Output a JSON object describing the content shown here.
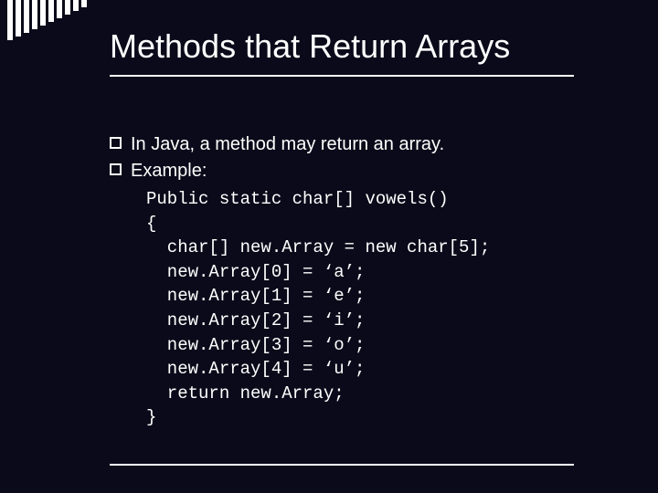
{
  "title": "Methods that Return Arrays",
  "bullets": [
    "In Java, a method may return an array.",
    "Example:"
  ],
  "code": "Public static char[] vowels()\n{\n  char[] new.Array = new char[5];\n  new.Array[0] = ‘a’;\n  new.Array[1] = ‘e’;\n  new.Array[2] = ‘i’;\n  new.Array[3] = ‘o’;\n  new.Array[4] = ‘u’;\n  return new.Array;\n}"
}
